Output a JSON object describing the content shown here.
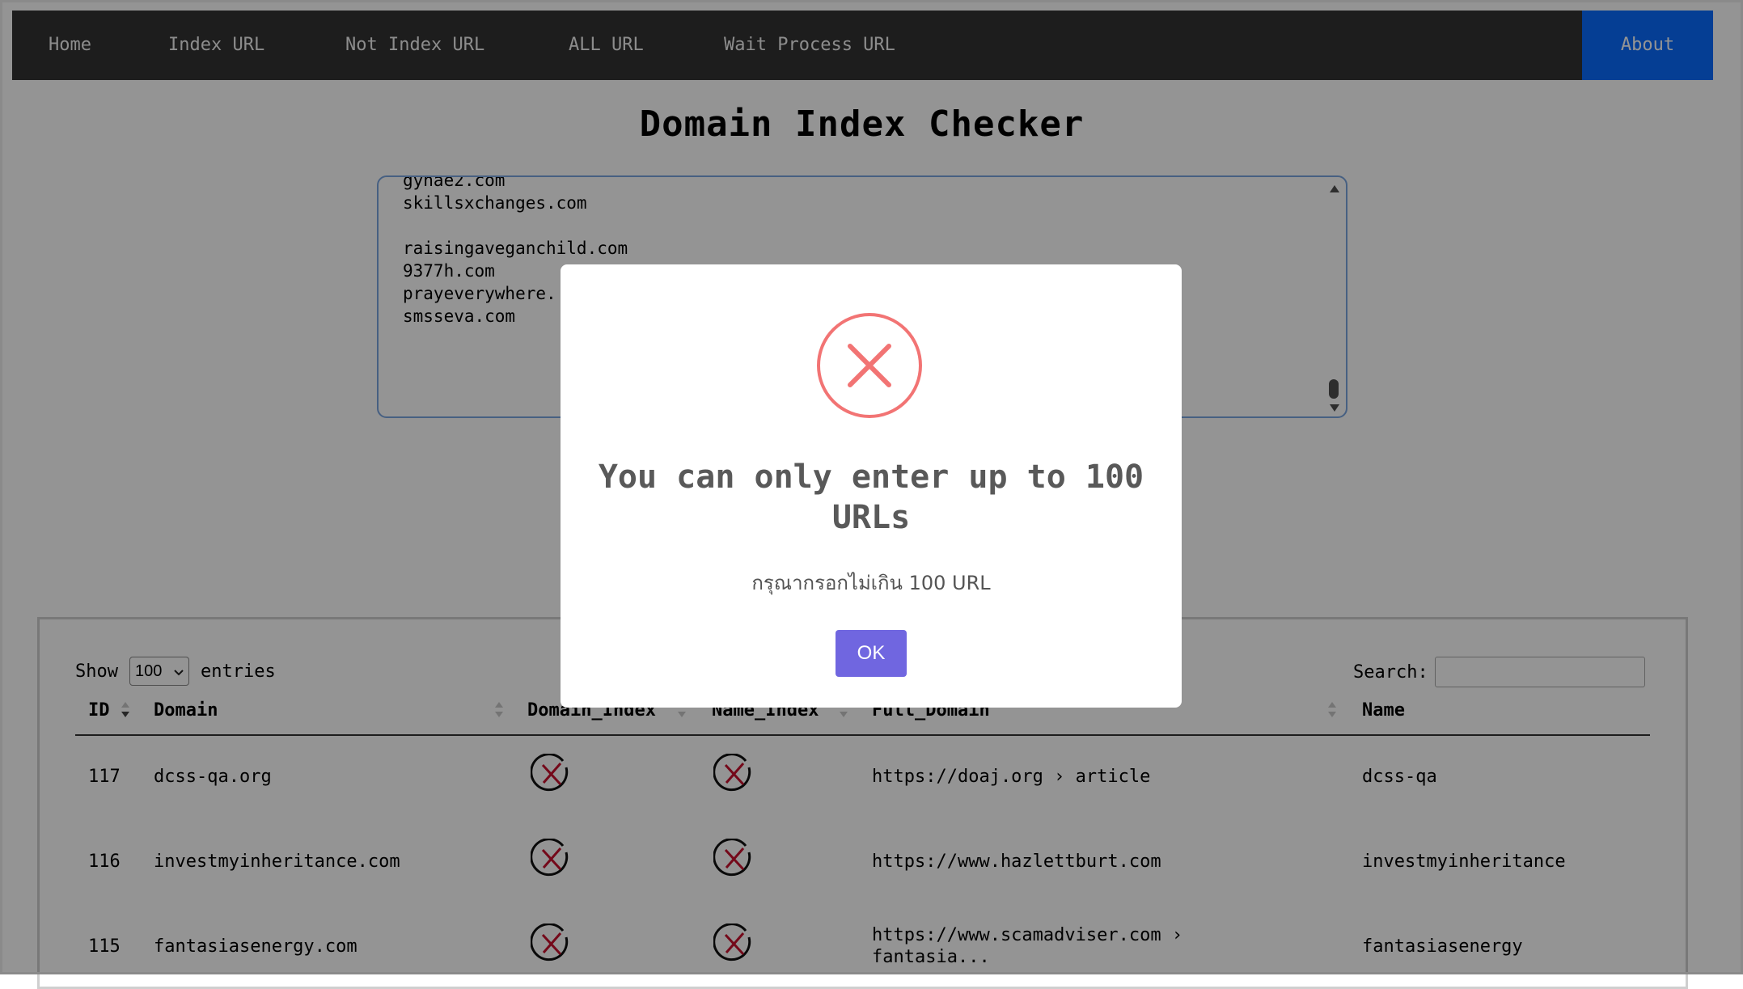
{
  "nav": {
    "items": [
      "Home",
      "Index URL",
      "Not Index URL",
      "ALL URL",
      "Wait Process URL"
    ],
    "about": "About"
  },
  "page_title": "Domain Index Checker",
  "textarea_lines": [
    "gynae2.com",
    "skillsxchanges.com",
    "",
    "raisingaveganchild.com",
    "9377h.com",
    "prayeverywhere.",
    "smsseva.com"
  ],
  "table": {
    "show_label": "Show",
    "entries_value": "100",
    "entries_label": "entries",
    "search_label": "Search:",
    "columns": [
      "ID",
      "Domain",
      "Domain_Index",
      "Name_Index",
      "Full_Domain",
      "Name"
    ],
    "rows": [
      {
        "id": "117",
        "domain": "dcss-qa.org",
        "domain_index": "not-indexed",
        "name_index": "not-indexed",
        "full_domain": "https://doaj.org › article",
        "full_domain_2": "",
        "name": "dcss-qa"
      },
      {
        "id": "116",
        "domain": "investmyinheritance.com",
        "domain_index": "not-indexed",
        "name_index": "not-indexed",
        "full_domain": "https://www.hazlettburt.com",
        "full_domain_2": "",
        "name": "investmyinheritance"
      },
      {
        "id": "115",
        "domain": "fantasiasenergy.com",
        "domain_index": "not-indexed",
        "name_index": "not-indexed",
        "full_domain": "https://www.scamadviser.com ›",
        "full_domain_2": "fantasia...",
        "name": "fantasiasenergy"
      }
    ]
  },
  "modal": {
    "icon": "error-x-icon",
    "title": "You can only enter up to 100 URLs",
    "text": "กรุณากรอกไม่เกิน 100 URL",
    "ok_label": "OK",
    "colors": {
      "icon": "#f27474",
      "button": "#7066e0"
    }
  }
}
